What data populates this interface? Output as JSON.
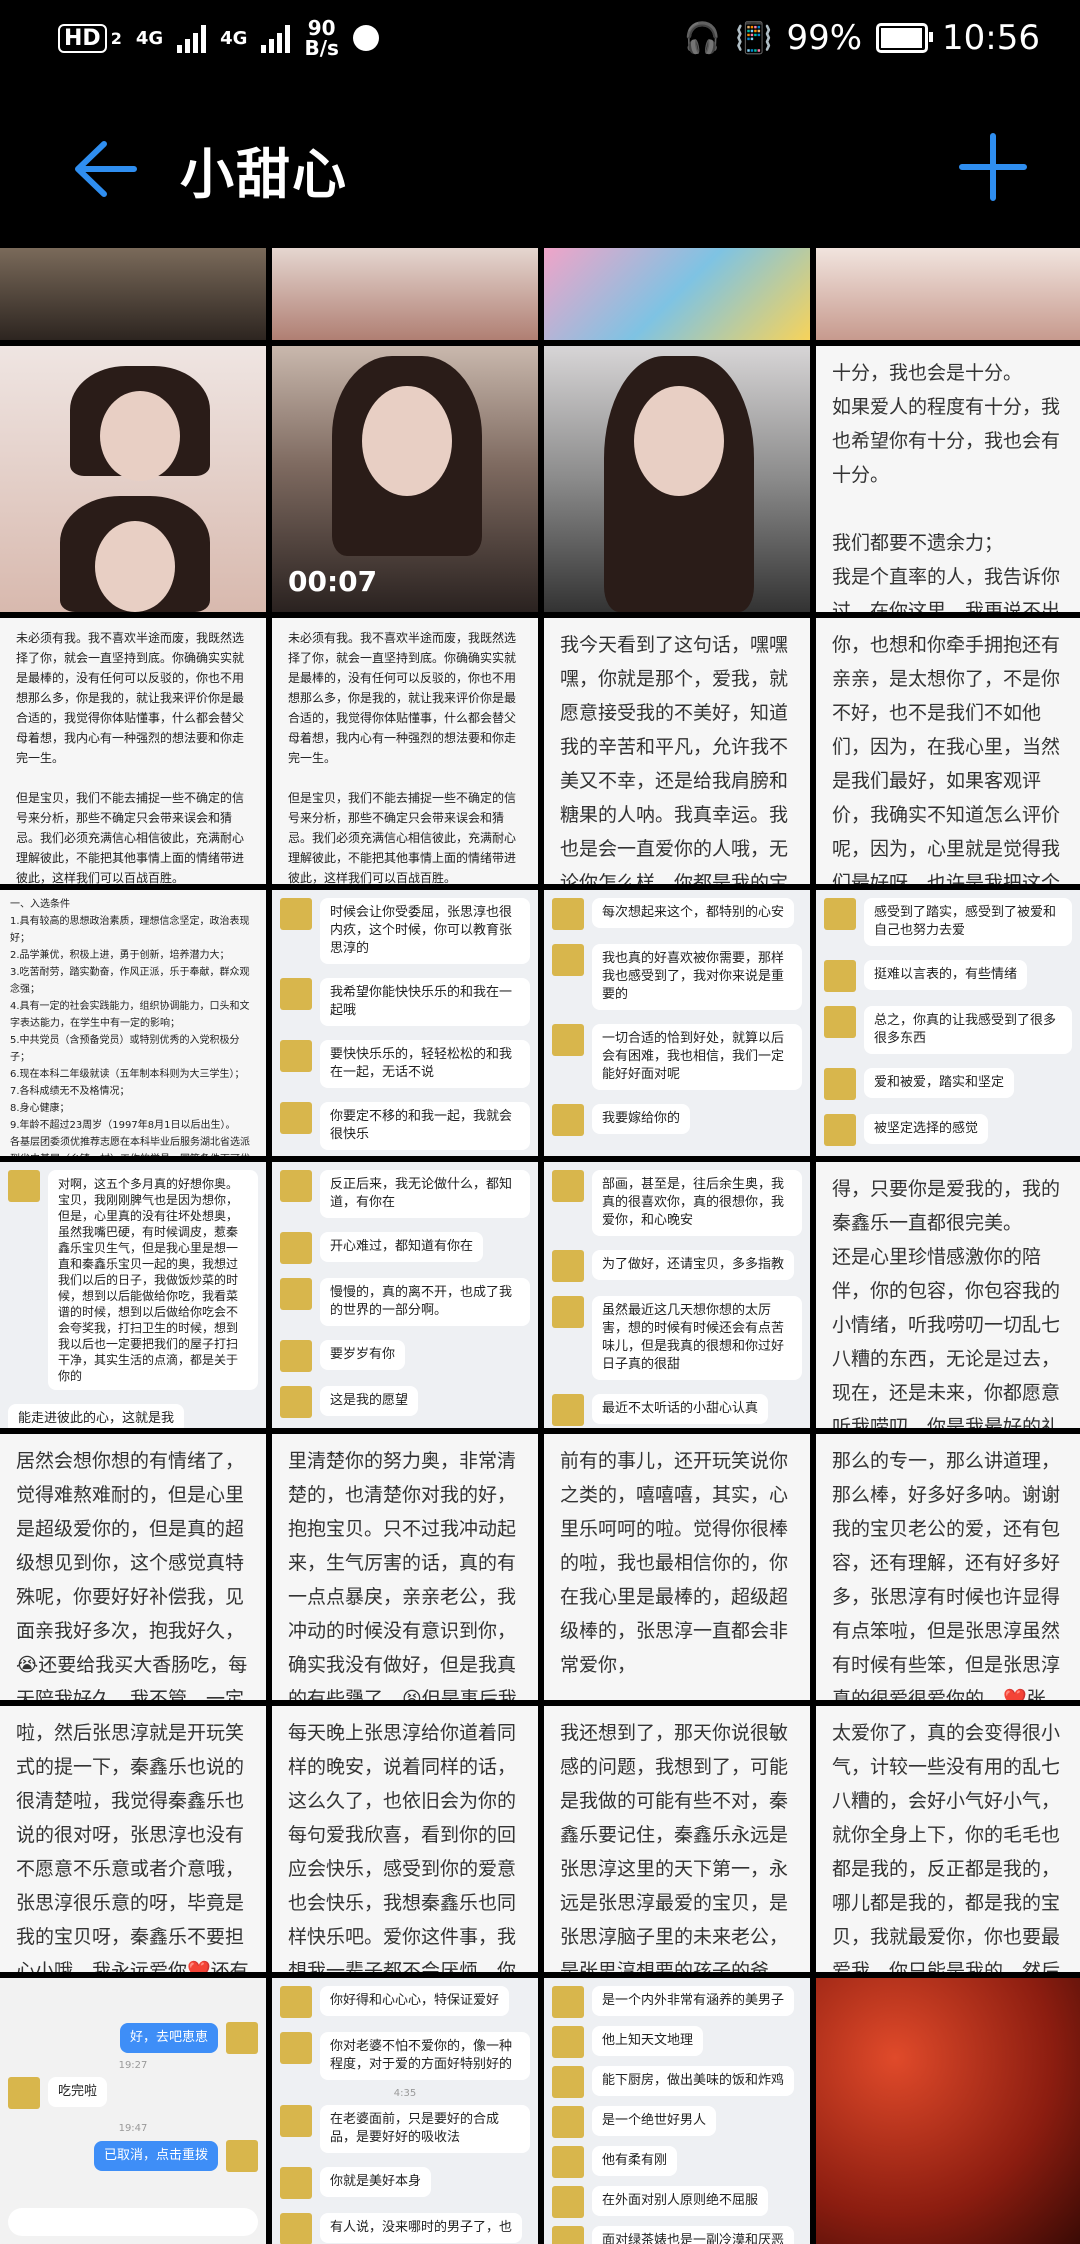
{
  "status_bar": {
    "left": {
      "hd": "HD",
      "sim1": "2",
      "net1": "4G",
      "net2": "4G",
      "speed_value": "90",
      "speed_unit": "B/s"
    },
    "right": {
      "battery_pct": "99%",
      "time": "10:56",
      "battery_level": 0.99
    }
  },
  "appbar": {
    "title": "小甜心"
  },
  "tiles": {
    "r2c4_text": "十分，我也会是十分。\n如果爱人的程度有十分，我也希望你有十分，我也会有十分。\n\n我们都要不遗余力；\n我是个直率的人，我告诉你过，在你这里，我更说不出假话，不高兴也是表现的明显，",
    "video_duration": "00:07",
    "r3c1_text": "未必须有我。我不喜欢半途而废，我既然选择了你，就会一直坚持到底。你确确实实就是最棒的，没有任何可以反驳的，你也不用想那么多，你是我的，就让我来评价你是最合适的，我觉得你体贴懂事，什么都会替父母着想，我内心有一种强烈的想法要和你走完一生。\n\n但是宝贝，我们不能去捕捉一些不确定的信号来分析，那些不确定只会带来误会和猜忌。我们必须充满信心相信彼此，充满耐心理解彼此，不能把其他事情上面的情绪带进彼此，这样我们可以百战百胜。\n\n再说一下我吧，我十分简单，没有杂乱和不老实的心，我想要的非常简单，未来的生活重有你，别的我一点都没想过，我也觉得你是最好的，我有充分的信心来守护...",
    "r3c2_text": "未必须有我。我不喜欢半途而废，我既然选择了你，就会一直坚持到底。你确确实实就是最棒的，没有任何可以反驳的，你也不用想那么多，你是我的，就让我来评价你是最合适的，我觉得你体贴懂事，什么都会替父母着想，我内心有一种强烈的想法要和你走完一生。\n\n但是宝贝，我们不能去捕捉一些不确定的信号来分析，那些不确定只会带来误会和猜忌。我们必须充满信心相信彼此，充满耐心理解彼此，不能把其他事情上面的情绪带进彼此，这样我们可以百战百胜。\n\n再说一下我吧，我十分简单，没有杂乱和不老实的心，我想要的非常简单，未来的生活重有你，别的我一点都没想过，我也觉得你是最好的，我有充分的",
    "r3c3_text": "我今天看到了这句话，嘿嘿嘿，你就是那个，爱我，就愿意接受我的不美好，知道我的辛苦和平凡，允许我不美又不幸，还是给我肩膀和糖果的人呐。我真幸运。我也是会一直爱你的人哦，无论你怎么样，你都是我的宝贝，张思淳发誓!!!嘻嘻嘻",
    "r3c4_text": "你，也想和你牵手拥抱还有亲亲，是太想你了，不是你不好，也不是我们不如他们，因为，在我心里，当然是我们最好，如果客观评价，我确实不知道怎么评价呢，因为，心里就是觉得我们最好呀，也许是我把这个问题，太认真去考虑了吧。\n确实很想你，也没有恶现哦，",
    "r4c1_lines": [
      "一、入选条件",
      "1.具有较高的思想政治素质，理想信念坚定，政治表现好；",
      "2.品学兼优，积极上进，勇于创新，培养潜力大；",
      "3.吃苦耐劳，踏实勤奋，作风正派，乐于奉献，群众观念强；",
      "4.具有一定的社会实践能力，组织协调能力，口头和文字表达能力，在学生中有一定的影响；",
      "5.中共党员（含预备党员）或特别优秀的入党积极分子；",
      "6.现在本科二年级就读（五年制本科则为大三学生）；",
      "7.各科成绩无不及格情况；",
      "8.身心健康；",
      "9.年龄不超过23周岁（1997年8月1日以后出生）。",
      "各基层团委须优推荐志愿在本科毕业后服务湖北省选派到省内基层（乡镇、村）工作的学员，同等条件下可优先推荐校园"
    ],
    "r4c2_msgs": [
      "时候会让你受委屈，张思淳也很内疚，这个时候，你可以教育张思淳的",
      "我希望你能快快乐乐的和我在一起哦",
      "要快快乐乐的，轻轻松松的和我在一起，无话不说",
      "你要定不移的和我一起，我就会很快乐"
    ],
    "r4c3_msgs": [
      "每次想起来这个，都特别的心安",
      "我也真的好喜欢被你需要，那样我也感受到了，我对你来说是重要的",
      "一切合适的恰到好处，就算以后会有困难，我也相信，我们一定能好好面对呢",
      "我要嫁给你的"
    ],
    "r4c4_msgs": [
      "感受到了踏实，感受到了被爱和自己也努力去爱",
      "挺难以言表的，有些情绪",
      "总之，你真的让我感受到了很多很多东西",
      "爱和被爱，踏实和坚定",
      "被坚定选择的感觉"
    ],
    "r5c1_msg": "对啊，这五个多月真的好想你奥。宝贝，我刚刚脾气也是因为想你，但是，心里真的没有往坏处想奥，虽然我嘴巴硬，有时候调皮，惹秦鑫乐宝贝生气，但是我心里是想一直和秦鑫乐宝贝一起的奥，我想过我们以后的日子，我做饭炒菜的时候，想到以后能做给你吃，我看菜谱的时候，想到以后做给你吃会不会夸奖我，打扫卫生的时候，想到我以后也一定要把我们的屋子打扫干净，其实生活的点滴，都是关于你的",
    "r5c1_msg2": "能走进彼此的心，这就是我",
    "r5c2_msgs": [
      "反正后来，我无论做什么，都知道，有你在",
      "开心难过，都知道有你在",
      "慢慢的，真的离不开，也成了我的世界的一部分啊。",
      "要岁岁有你",
      "这是我的愿望"
    ],
    "r5c3_msgs": [
      "部画，甚至是，往后余生奥，我真的很喜欢你，真的很想你，我爱你，和心晚安",
      "为了做好，还请宝贝，多多指教",
      "虽然最近这几天想你想的太厉害，想的时候有时候还会有点苦味儿，但是我真的很想和你过好日子真的很甜",
      "最近不太听话的小甜心认真"
    ],
    "r5c4_text": "得，只要你是爱我的，我的秦鑫乐一直都很完美。\n还是心里珍惜感激你的陪伴，你的包容，你包容我的小情绪，听我唠叨一切乱七八糟的东西，无论是过去，现在，还是未来，你都愿意听我唠叨，你是我最好的礼物了，我心里都清楚，真的超级感谢上天给我",
    "r6c1_text": "居然会想你想的有情绪了，觉得难熬难耐的，但是心里是超级爱你的，但是真的超级想见到你，这个感觉真特殊呢，你要好好补偿我，见面亲我好多次，抱我好久，😭还要给我买大香肠吃，每天陪我好久，我不管，一定要😭我真的太想你了，呜呜呜呜呜呜，你一定要好好爱我哦，小傻瓜容易吗，",
    "r6c2_text": "里清楚你的努力奥，非常清楚的，也清楚你对我的好，抱抱宝贝。只不过我冲动起来，生气厉害的话，真的有一点点暴戾，亲亲老公，我冲动的时候没有意识到你，确实我没有做好，但是我真的有些犟了，😫但是事后我会好好安慰你的，如果是当面就好解决多了，我",
    "r6c3_text": "前有的事儿，还开玩笑说你之类的，嘻嘻嘻，其实，心里乐呵呵的啦。觉得你很棒的啦，我也最相信你的，你在我心里是最棒的，超级超级棒的，张思淳一直都会非常爱你，",
    "r6c4_text": "那么的专一，那么讲道理，那么棒，好多好多呐。谢谢我的宝贝老公的爱，还有包容，还有理解，还有好多好多，张思淳有时候也许显得有点笨啦，但是张思淳虽然有时候有些笨，但是张思淳真的很爱很爱你的，❤️张思淳做错了什么，说错了什么，有一点点不",
    "r7c1_text": "啦，然后张思淳就是开玩笑式的提一下，秦鑫乐也说的很清楚啦，我觉得秦鑫乐也说的很对呀，张思淳也没有不愿意不乐意或者介意哦，张思淳很乐意的呀，毕竟是我的宝贝呀，秦鑫乐不要担心小哦，我永远爱你❤️还有你真的好棒，每次都引导我解决问题，怕我是不是憋在心里了，超级棒，有你",
    "r7c2_text": "每天晚上张思淳给你道着同样的晚安，说着同样的话，这么久了，也依旧会为你的每句爱我欣喜，看到你的回应会快乐，感受到你的爱意也会快乐，我想秦鑫乐也同样快乐吧。爱你这件事，我想我一辈子都不会厌烦，你也要一直爱我。muα",
    "r7c3_text": "我还想到了，那天你说很敏感的问题，我想到了，可能是我做的可能有些不对，秦鑫乐要记住，秦鑫乐永远是张思淳这里的天下第一，永远是张思淳最爱的宝贝，是张思淳脑子里的未来老公，是张思淳想要的孩子的爸爸，是张思淳的男神，是最棒的人。\n我真的有认真的思考过，以后",
    "r7c4_text": "太爱你了，真的会变得很小气，计较一些没有用的乱七八糟的，会好小气好小气，就你全身上下，你的毛毛也都是我的，反正都是我的，哪儿都是我的，都是我的宝贝，我就最爱你，你也要最爱我，你只能是我的。然后就这么胡思乱想，这么的胡闹😅",
    "r8c1": {
      "msg1": "好，去吧恵恵",
      "time1": "19:27",
      "msg2": "吃完啦",
      "time2": "19:47",
      "msg3": "已取消，点击重拨"
    },
    "r8c2_msgs": [
      "你好得和心心心，特保证爱好",
      "你对老婆不怕不爱你的，像一种程度，对于爱的方面好特别好的",
      "在老婆面前，只是要好的合成品，是要好好的吸收法",
      "你就是美好本身",
      "有人说，没来哪时的男子了，也"
    ],
    "r8c2_time": "4:35",
    "r8c3_msgs": [
      "是一个内外非常有涵养的美男子",
      "他上知天文地理",
      "能下厨房，做出美味的饭和炸鸡",
      "是一个绝世好男人",
      "他有柔有刚",
      "在外面对别人原则绝不屈服",
      "面对绿茶婊也是一副冷漠和厌恶"
    ]
  }
}
